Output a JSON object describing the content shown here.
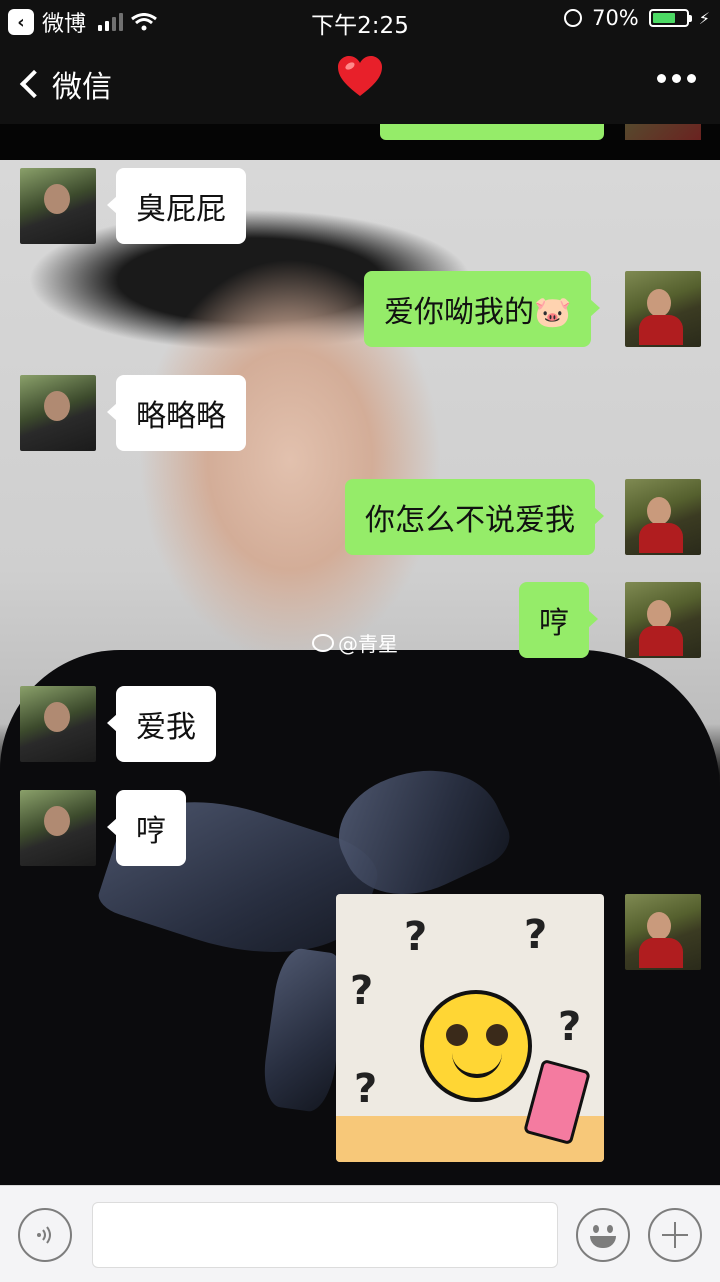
{
  "status_bar": {
    "back_app_label": "微博",
    "time": "下午2:25",
    "battery_percent": "70%",
    "battery_level": 0.7
  },
  "nav": {
    "back_label": "微信",
    "title_emoji": "❤️"
  },
  "messages": [
    {
      "from": "friend",
      "text": "臭屁屁"
    },
    {
      "from": "me",
      "text": "爱你呦我的🐷"
    },
    {
      "from": "friend",
      "text": "略略略"
    },
    {
      "from": "me",
      "text": "你怎么不说爱我"
    },
    {
      "from": "me",
      "text": "哼"
    },
    {
      "from": "friend",
      "text": "爱我"
    },
    {
      "from": "friend",
      "text": "哼"
    },
    {
      "from": "me",
      "type": "sticker"
    }
  ],
  "watermark": "@青星"
}
